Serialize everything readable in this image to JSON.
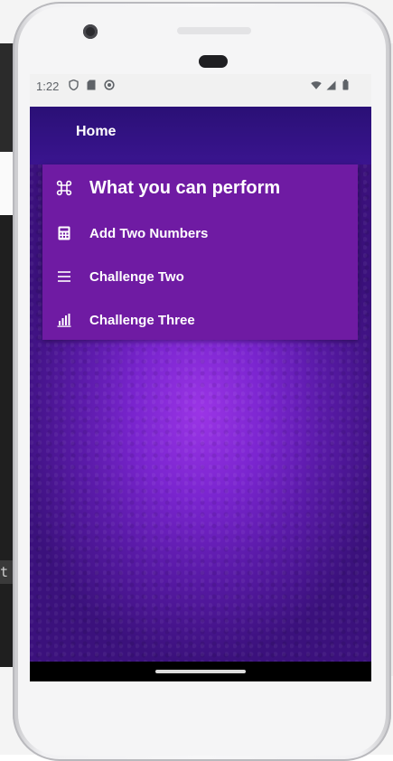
{
  "status_bar": {
    "time": "1:22",
    "icons": [
      "shield-icon",
      "sd-card-icon",
      "circle-status-icon",
      "wifi-icon",
      "cell-signal-icon",
      "battery-icon"
    ]
  },
  "app": {
    "title": "Home",
    "menu": {
      "header": {
        "icon": "command-icon",
        "label": "What you can perform"
      },
      "items": [
        {
          "icon": "calculator-icon",
          "label": "Add Two Numbers"
        },
        {
          "icon": "list-icon",
          "label": "Challenge Two"
        },
        {
          "icon": "bar-chart-icon",
          "label": "Challenge Three"
        }
      ]
    }
  },
  "desktop": {
    "left_fragment": "t"
  },
  "colors": {
    "menu_card": "#6f1ba3",
    "background_glow": "#9b35e6",
    "background_dark": "#3b117c",
    "text": "#ffffff"
  }
}
